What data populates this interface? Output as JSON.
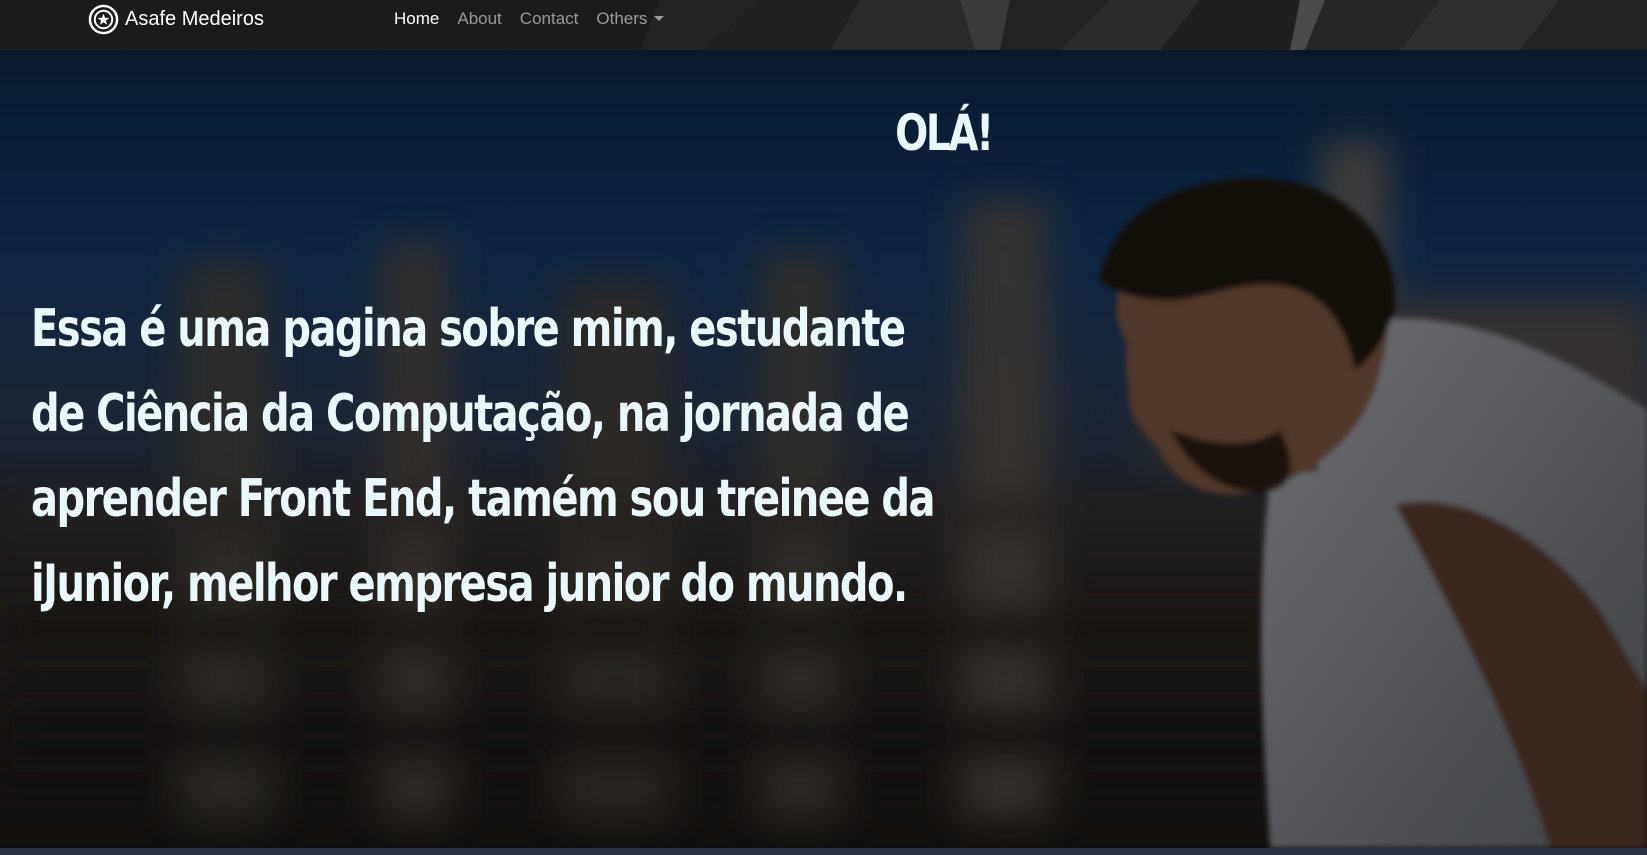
{
  "navbar": {
    "brand_icon": "circle-star-icon",
    "brand_name": "Asafe Medeiros",
    "links": [
      {
        "label": "Home",
        "active": true
      },
      {
        "label": "About",
        "active": false
      },
      {
        "label": "Contact",
        "active": false
      },
      {
        "label": "Others",
        "active": false,
        "dropdown": true
      }
    ]
  },
  "hero": {
    "heading": "OLÁ!",
    "text": "Essa é uma pagina sobre mim, estudante de Ciência da Computação, na jornada de aprender Front End, tamém sou treinee da iJunior, melhor empresa junior do mundo."
  },
  "colors": {
    "navbar_bg": "#1a1a1c",
    "hero_text": "#eaf8fb",
    "nav_active": "#ffffff",
    "nav_inactive": "#8c8c8c"
  }
}
